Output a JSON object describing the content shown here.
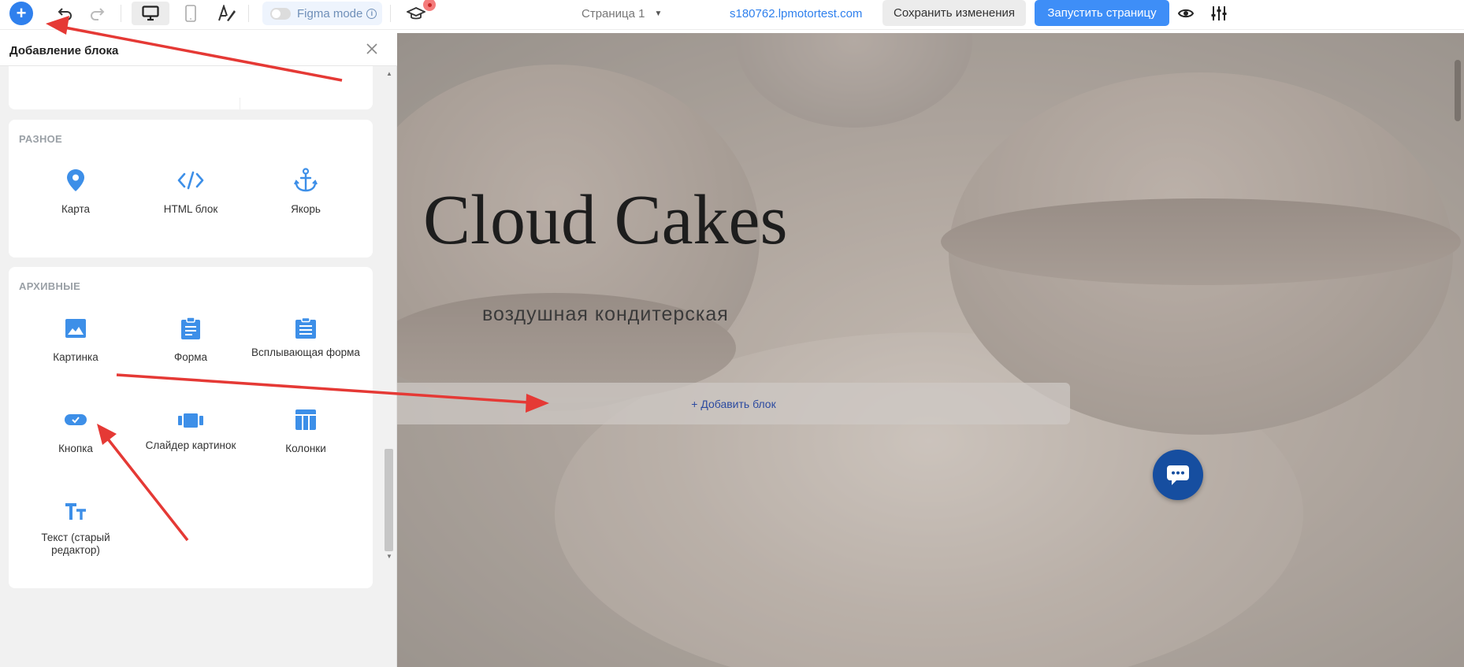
{
  "toolbar": {
    "add_icon": "+",
    "undo_icon": "undo-icon",
    "redo_icon": "redo-icon",
    "figma_mode_label": "Figma mode",
    "info_icon": "i",
    "page_selector": "Страница 1",
    "domain": "s180762.lpmotortest.com",
    "save_label": "Сохранить изменения",
    "launch_label": "Запустить страницу"
  },
  "panel": {
    "title": "Добавление блока",
    "sections": [
      {
        "title": "РАЗНОЕ",
        "items": [
          {
            "label": "Карта",
            "icon": "map-pin-icon"
          },
          {
            "label": "HTML блок",
            "icon": "code-icon"
          },
          {
            "label": "Якорь",
            "icon": "anchor-icon"
          }
        ]
      },
      {
        "title": "АРХИВНЫЕ",
        "items": [
          {
            "label": "Картинка",
            "icon": "image-icon"
          },
          {
            "label": "Форма",
            "icon": "clipboard-form-icon"
          },
          {
            "label": "Всплывающая форма",
            "icon": "clipboard-popup-icon"
          },
          {
            "label": "Кнопка",
            "icon": "button-icon"
          },
          {
            "label": "Слайдер картинок",
            "icon": "slider-icon"
          },
          {
            "label": "Колонки",
            "icon": "columns-icon"
          },
          {
            "label": "Текст (старый редактор)",
            "icon": "text-icon"
          }
        ]
      }
    ]
  },
  "canvas": {
    "hero_title": "Cloud Cakes",
    "hero_subtitle": "воздушная кондитерская",
    "add_block_label": "+ Добавить блок"
  },
  "colors": {
    "accent": "#2f80ed",
    "launch": "#3e8ef7",
    "icon_blue": "#3d8fe8",
    "arrow": "#e53935",
    "chat": "#164ea0"
  }
}
